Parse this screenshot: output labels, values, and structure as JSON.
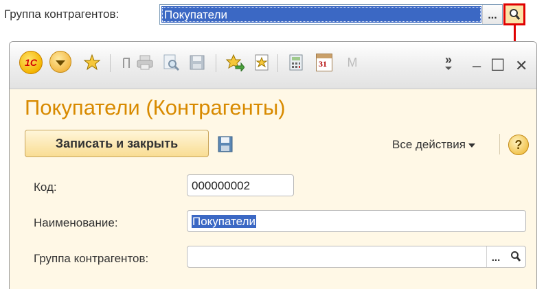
{
  "top": {
    "label": "Группа контрагентов:",
    "field_value": "Покупатели",
    "choose_button": "..."
  },
  "window": {
    "logo": "1C",
    "toolbar_icons": [
      "menu-icon",
      "star-icon",
      "history-icon",
      "print-icon",
      "preview-icon",
      "save-icon",
      "favorites-add-icon",
      "favorites-icon",
      "calculator-icon",
      "calendar-icon",
      "m-icon",
      "more-icon"
    ],
    "calendar_day": "31",
    "m_label": "M",
    "more_label": "»",
    "minimize": "–",
    "maximize": "☐",
    "close": "✕",
    "title": "Покупатели (Контрагенты)",
    "save_close_label": "Записать и закрыть",
    "all_actions_label": "Все действия",
    "help_label": "?",
    "fields": {
      "code_label": "Код:",
      "code_value": "000000002",
      "name_label": "Наименование:",
      "name_value": "Покупатели",
      "group_label": "Группа контрагентов:",
      "group_value": "",
      "group_choose": "..."
    }
  },
  "colors": {
    "accent_title": "#d88a00",
    "selection": "#3b68c4",
    "highlight_box": "#e00000",
    "window_bg": "#fff8e6"
  }
}
